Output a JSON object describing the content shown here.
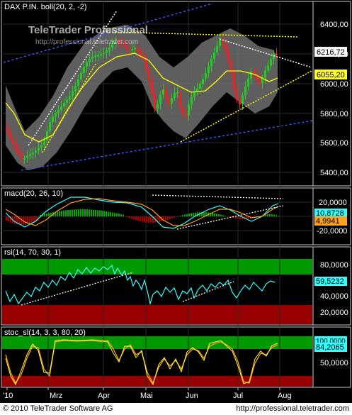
{
  "panels": [
    {
      "id": "price",
      "title": "DAX P.IN. boll(20, 2, -2)",
      "yTicks": [
        "6400,00",
        "6200,00",
        "6000,00",
        "5800,00",
        "5600,00",
        "5400,00"
      ],
      "labels": [
        {
          "text": "6216,72",
          "bg": "#f5f5f5",
          "fg": "#000000"
        },
        {
          "text": "6055,20",
          "bg": "#ffff33",
          "fg": "#000000"
        }
      ]
    },
    {
      "id": "macd",
      "title": "macd(20, 26, 10)",
      "yTicks": [
        "20,0000",
        "-20,0000"
      ],
      "labels": [
        {
          "text": "10,8728",
          "bg": "#33ffff",
          "fg": "#000000"
        },
        {
          "text": "4,9941",
          "bg": "#ffa020",
          "fg": "#000000"
        }
      ]
    },
    {
      "id": "rsi",
      "title": "rsi(14, 70, 30, 1)",
      "yTicks": [
        "80,0000",
        "40,0000",
        "20,0000"
      ],
      "labels": [
        {
          "text": "59,5232",
          "bg": "#33ffff",
          "fg": "#000000"
        }
      ]
    },
    {
      "id": "stoc",
      "title": "stoc_sl(14, 3, 3, 80, 20)",
      "yTicks": [
        "50,0000"
      ],
      "labels": [
        {
          "text": "100,0000",
          "bg": "#33ffff",
          "fg": "#000000"
        },
        {
          "text": "84,2065",
          "bg": "#33ffff",
          "fg": "#000000"
        }
      ]
    }
  ],
  "xAxis": [
    "'10",
    "Mrz",
    "Apr",
    "Mai",
    "Jun",
    "Jul",
    "Aug"
  ],
  "watermark": {
    "title": "TeleTrader Professional",
    "url": "http://professional.teletrader.com"
  },
  "footer": {
    "copyright": "© 2010 TeleTrader Software AG",
    "url": "http://professional.teletrader.com"
  },
  "colors": {
    "background": "#000000",
    "panelBorder": "#c8c8c8",
    "grid": "#2a2a2a",
    "band": "#7a7a7a",
    "candleUp": "#22cc22",
    "candleDown": "#ee2222",
    "midline": "#ffff00",
    "cyan": "#33ffff",
    "orange": "#ffa020",
    "blueTrend": "#3355ff",
    "green": "#00aa00",
    "red": "#aa0000"
  }
}
